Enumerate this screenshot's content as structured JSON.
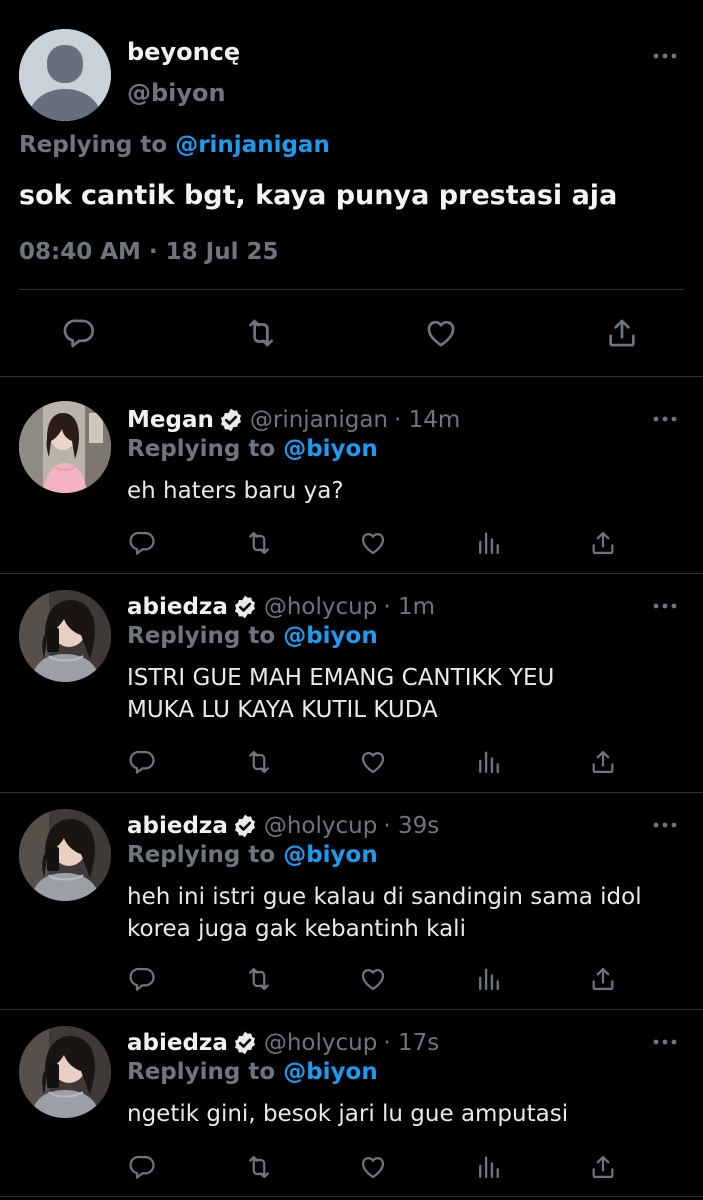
{
  "main_tweet": {
    "name": "beyoncę",
    "handle": "@biyon",
    "replying_prefix": "Replying to",
    "replying_to": "@rinjanigan",
    "text": "sok cantik bgt, kaya punya prestasi aja",
    "time": "08:40 AM · 18 Jul 25"
  },
  "replies": [
    {
      "name": "Megan",
      "verified": true,
      "handle": "@rinjanigan",
      "time_ago": "· 14m",
      "replying_prefix": "Replying to",
      "replying_to": "@biyon",
      "lines": [
        "eh haters baru ya?"
      ]
    },
    {
      "name": "abiedza",
      "verified": true,
      "handle": "@holycup",
      "time_ago": "· 1m",
      "replying_prefix": "Replying to",
      "replying_to": "@biyon",
      "lines": [
        "ISTRI GUE MAH EMANG CANTIKK YEU",
        "MUKA LU KAYA KUTIL KUDA"
      ]
    },
    {
      "name": "abiedza",
      "verified": true,
      "handle": "@holycup",
      "time_ago": "· 39s",
      "replying_prefix": "Replying to",
      "replying_to": "@biyon",
      "lines": [
        "heh ini istri gue kalau di sandingin sama idol",
        "korea juga gak kebantinh kali"
      ]
    },
    {
      "name": "abiedza",
      "verified": true,
      "handle": "@holycup",
      "time_ago": "· 17s",
      "replying_prefix": "Replying to",
      "replying_to": "@biyon",
      "lines": [
        "ngetik gini, besok jari lu gue amputasi"
      ]
    }
  ],
  "colors": {
    "background": "#000000",
    "text": "#e7e9ea",
    "muted": "#6e767d",
    "accent": "#1d9bf0",
    "divider": "#2f3336"
  },
  "icons": [
    "more-icon",
    "reply-icon",
    "retweet-icon",
    "like-icon",
    "share-icon",
    "analytics-icon",
    "verified-badge-icon",
    "default-avatar-icon"
  ]
}
